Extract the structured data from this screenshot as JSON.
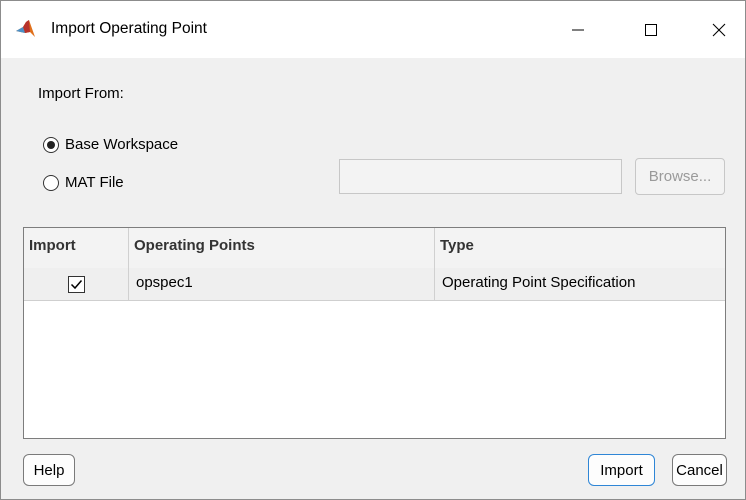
{
  "window": {
    "title": "Import Operating Point"
  },
  "import_from": {
    "label": "Import From:",
    "options": [
      {
        "label": "Base Workspace",
        "selected": true
      },
      {
        "label": "MAT File",
        "selected": false
      }
    ],
    "file_path_value": "",
    "browse_label": "Browse..."
  },
  "table": {
    "headers": [
      "Import",
      "Operating Points",
      "Type"
    ],
    "rows": [
      {
        "import": true,
        "operating_point": "opspec1",
        "type": "Operating Point Specification"
      }
    ]
  },
  "buttons": {
    "help": "Help",
    "import": "Import",
    "cancel": "Cancel"
  },
  "colors": {
    "accent": "#2f86d6",
    "matlab_orange": "#e0701b",
    "matlab_red": "#b7322b"
  },
  "icons": {
    "app": "matlab-logo-icon",
    "minimize": "minimize-icon",
    "maximize": "maximize-icon",
    "close": "close-icon"
  }
}
